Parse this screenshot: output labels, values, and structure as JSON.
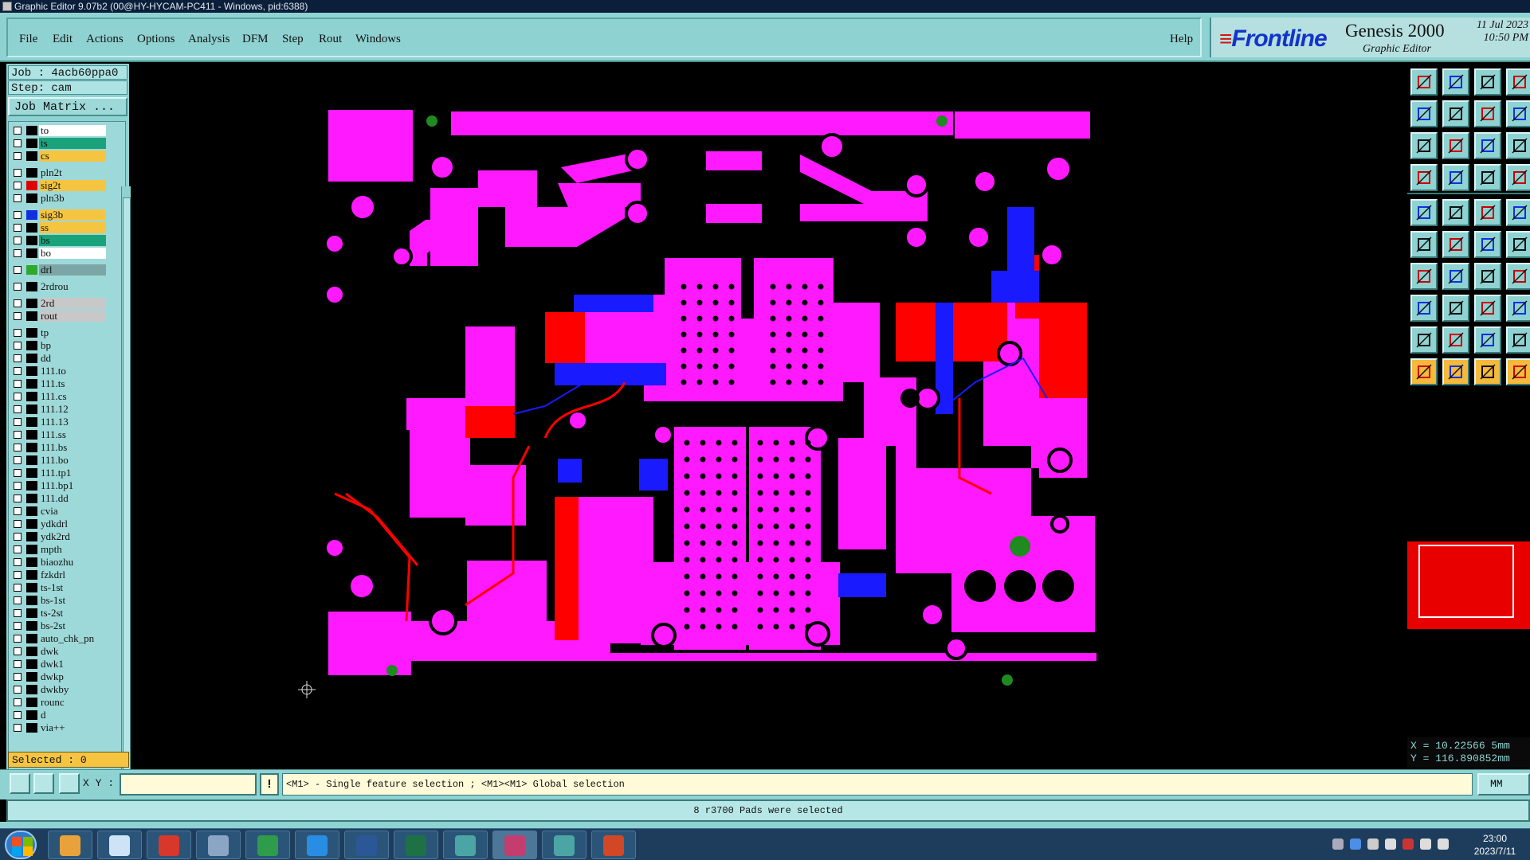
{
  "window": {
    "title": "Graphic Editor 9.07b2 (00@HY-HYCAM-PC411 - Windows, pid:6388)"
  },
  "menu": {
    "items": [
      "File",
      "Edit",
      "Actions",
      "Options",
      "Analysis",
      "DFM",
      "Step",
      "Rout",
      "Windows"
    ],
    "help": "Help"
  },
  "brand": {
    "logo": "Frontline",
    "product": "Genesis 2000",
    "subtitle": "Graphic Editor",
    "date": "11 Jul 2023",
    "time": "10:50 PM"
  },
  "job": {
    "job_label": "Job : 4acb60ppa0",
    "step_label": "Step: cam",
    "matrix_button": "Job Matrix ..."
  },
  "layers": [
    {
      "name": "to",
      "color": "#ffffff",
      "swatch": "#000000"
    },
    {
      "name": "ts",
      "color": "#1aa37a",
      "swatch": "#000000"
    },
    {
      "name": "cs",
      "color": "#f5c542",
      "swatch": "#000000"
    },
    {
      "name": "pln2t",
      "color": "#9ed9d9",
      "swatch": "#000000"
    },
    {
      "name": "sig2t",
      "color": "#f5c542",
      "swatch": "#e00000"
    },
    {
      "name": "pln3b",
      "color": "#9ed9d9",
      "swatch": "#000000"
    },
    {
      "name": "sig3b",
      "color": "#f5c542",
      "swatch": "#1030e0"
    },
    {
      "name": "ss",
      "color": "#f5c542",
      "swatch": "#000000"
    },
    {
      "name": "bs",
      "color": "#1aa37a",
      "swatch": "#000000"
    },
    {
      "name": "bo",
      "color": "#ffffff",
      "swatch": "#000000"
    },
    {
      "name": "drl",
      "color": "#7ca6a6",
      "swatch": "#2ea82e"
    },
    {
      "name": "2rdrou",
      "color": "#9ed9d9",
      "swatch": "#000000"
    },
    {
      "name": "2rd",
      "color": "#c8c8c8",
      "swatch": "#000000"
    },
    {
      "name": "rout",
      "color": "#c8c8c8",
      "swatch": "#000000"
    },
    {
      "name": "tp",
      "color": "#9ed9d9",
      "swatch": "#000000"
    },
    {
      "name": "bp",
      "color": "#9ed9d9",
      "swatch": "#000000"
    },
    {
      "name": "dd",
      "color": "#9ed9d9",
      "swatch": "#000000"
    },
    {
      "name": "111.to",
      "color": "#9ed9d9",
      "swatch": "#000000"
    },
    {
      "name": "111.ts",
      "color": "#9ed9d9",
      "swatch": "#000000"
    },
    {
      "name": "111.cs",
      "color": "#9ed9d9",
      "swatch": "#000000"
    },
    {
      "name": "111.12",
      "color": "#9ed9d9",
      "swatch": "#000000"
    },
    {
      "name": "111.13",
      "color": "#9ed9d9",
      "swatch": "#000000"
    },
    {
      "name": "111.ss",
      "color": "#9ed9d9",
      "swatch": "#000000"
    },
    {
      "name": "111.bs",
      "color": "#9ed9d9",
      "swatch": "#000000"
    },
    {
      "name": "111.bo",
      "color": "#9ed9d9",
      "swatch": "#000000"
    },
    {
      "name": "111.tp1",
      "color": "#9ed9d9",
      "swatch": "#000000"
    },
    {
      "name": "111.bp1",
      "color": "#9ed9d9",
      "swatch": "#000000"
    },
    {
      "name": "111.dd",
      "color": "#9ed9d9",
      "swatch": "#000000"
    },
    {
      "name": "cvia",
      "color": "#9ed9d9",
      "swatch": "#000000"
    },
    {
      "name": "ydkdrl",
      "color": "#9ed9d9",
      "swatch": "#000000"
    },
    {
      "name": "ydk2rd",
      "color": "#9ed9d9",
      "swatch": "#000000"
    },
    {
      "name": "mpth",
      "color": "#9ed9d9",
      "swatch": "#000000"
    },
    {
      "name": "biaozhu",
      "color": "#9ed9d9",
      "swatch": "#000000"
    },
    {
      "name": "fzkdrl",
      "color": "#9ed9d9",
      "swatch": "#000000"
    },
    {
      "name": "ts-1st",
      "color": "#9ed9d9",
      "swatch": "#000000"
    },
    {
      "name": "bs-1st",
      "color": "#9ed9d9",
      "swatch": "#000000"
    },
    {
      "name": "ts-2st",
      "color": "#9ed9d9",
      "swatch": "#000000"
    },
    {
      "name": "bs-2st",
      "color": "#9ed9d9",
      "swatch": "#000000"
    },
    {
      "name": "auto_chk_pn",
      "color": "#9ed9d9",
      "swatch": "#000000"
    },
    {
      "name": "dwk",
      "color": "#9ed9d9",
      "swatch": "#000000"
    },
    {
      "name": "dwk1",
      "color": "#9ed9d9",
      "swatch": "#000000"
    },
    {
      "name": "dwkp",
      "color": "#9ed9d9",
      "swatch": "#000000"
    },
    {
      "name": "dwkby",
      "color": "#9ed9d9",
      "swatch": "#000000"
    },
    {
      "name": "rounc",
      "color": "#9ed9d9",
      "swatch": "#000000"
    },
    {
      "name": "d",
      "color": "#9ed9d9",
      "swatch": "#000000"
    },
    {
      "name": "via++",
      "color": "#9ed9d9",
      "swatch": "#000000"
    }
  ],
  "selection": {
    "label": "Selected : 0"
  },
  "coords": {
    "x": "X = 10.22566 5mm",
    "y": "Y = 116.890852mm"
  },
  "command": {
    "xy_label": "X Y :",
    "xy_value": "",
    "hint": "<M1> - Single feature selection ; <M1><M1> Global selection",
    "units": "MM"
  },
  "status": {
    "message": "8 r3700 Pads were selected"
  },
  "taskbar": {
    "time": "23:00",
    "date": "2023/7/11"
  },
  "colors": {
    "copper": "#ff19ff",
    "sig_top": "#ff0000",
    "sig_bottom": "#1a1aff",
    "drill": "#1f8a1f",
    "panel": "#8fd2d2"
  },
  "icons": {
    "tools": [
      "home-icon",
      "save-step-icon",
      "open-icon",
      "window-icon",
      "back-icon",
      "forward-icon",
      "zoom-out-icon",
      "zoom-reset-icon",
      "fit-icon",
      "center-icon",
      "ratio-icon",
      "help-icon",
      "measure-icon",
      "snap-icon",
      "layers-icon",
      "grid-icon",
      "add-pad-icon",
      "add-surface-icon",
      "add-text-icon",
      "add-hole-icon",
      "move-icon",
      "delete-icon",
      "rotate-icon",
      "arc-icon",
      "line-icon",
      "slash-icon",
      "curve-icon",
      "route-icon",
      "point-icon",
      "minus-icon",
      "resize-icon",
      "flip-icon",
      "triangle-icon",
      "mountain-icon",
      "peak-icon",
      "arrow-up-icon",
      "select-pointer-icon",
      "select-move-icon",
      "select-lasso-icon",
      "select-box-icon"
    ]
  }
}
